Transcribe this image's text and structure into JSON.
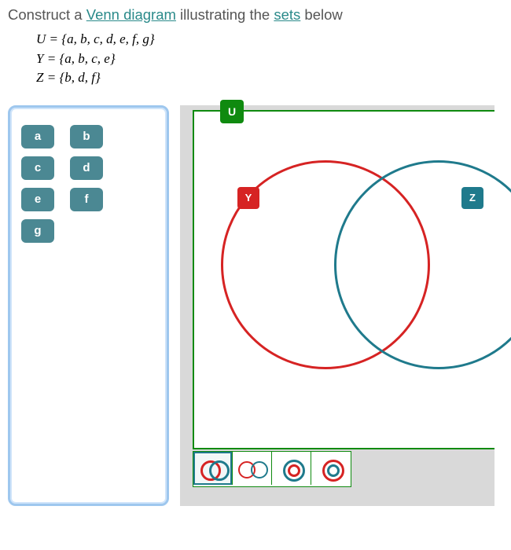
{
  "prompt": {
    "pre": "Construct a ",
    "link1": "Venn diagram",
    "mid": " illustrating the ",
    "link2": "sets",
    "post": " below"
  },
  "sets": {
    "U": {
      "name": "U",
      "elements": "a, b, c, d, e, f, g"
    },
    "Y": {
      "name": "Y",
      "elements": "a, b, c, e"
    },
    "Z": {
      "name": "Z",
      "elements": "b, d, f"
    }
  },
  "palette": [
    "a",
    "b",
    "c",
    "d",
    "e",
    "f",
    "g"
  ],
  "labels": {
    "U": "U",
    "Y": "Y",
    "Z": "Z"
  },
  "colors": {
    "Y": "#d62323",
    "Z": "#1f7a8c",
    "U": "#0f8a0f",
    "chip": "#4b8893"
  },
  "toolbar": {
    "selected": 0,
    "tools": [
      "two-overlap-filled",
      "two-overlap-outline",
      "single-ring-red-teal",
      "single-ring-teal-red"
    ]
  }
}
